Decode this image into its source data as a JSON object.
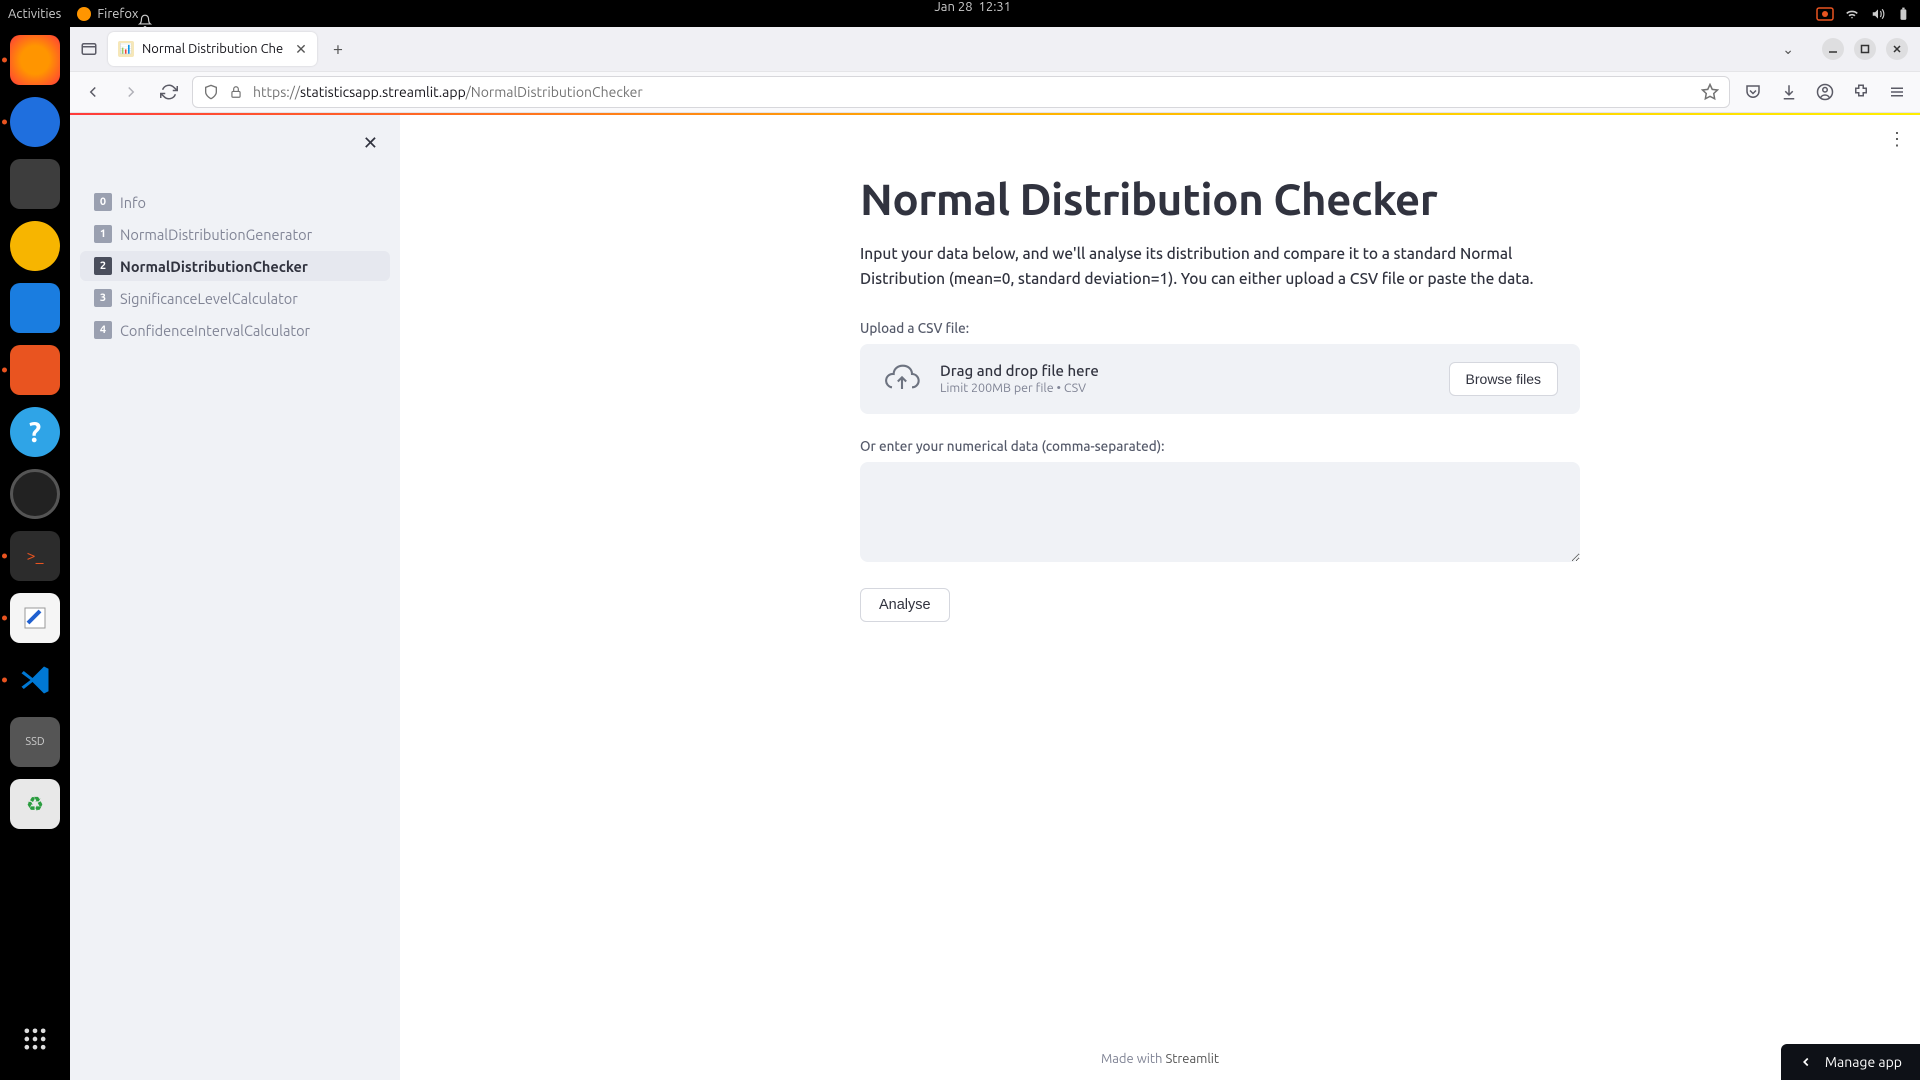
{
  "topbar": {
    "activities": "Activities",
    "app_name": "Firefox",
    "date": "Jan 28",
    "time": "12:31"
  },
  "browser": {
    "tab_title": "Normal Distribution Che",
    "url_scheme": "https://",
    "url_host": "statisticsapp.streamlit.app",
    "url_path": "/NormalDistributionChecker"
  },
  "sidebar": {
    "items": [
      {
        "num": "0",
        "label": "Info"
      },
      {
        "num": "1",
        "label": "NormalDistributionGenerator"
      },
      {
        "num": "2",
        "label": "NormalDistributionChecker"
      },
      {
        "num": "3",
        "label": "SignificanceLevelCalculator"
      },
      {
        "num": "4",
        "label": "ConfidenceIntervalCalculator"
      }
    ],
    "selected_index": 2
  },
  "main": {
    "title": "Normal Distribution Checker",
    "description": "Input your data below, and we'll analyse its distribution and compare it to a standard Normal Distribution (mean=0, standard deviation=1). You can either upload a CSV file or paste the data.",
    "upload_label": "Upload a CSV file:",
    "uploader": {
      "line1": "Drag and drop file here",
      "line2": "Limit 200MB per file • CSV",
      "browse_label": "Browse files"
    },
    "textarea_label": "Or enter your numerical data (comma-separated):",
    "analyse_label": "Analyse"
  },
  "footer": {
    "made_with": "Made with ",
    "streamlit": "Streamlit"
  },
  "manage_app": "Manage app"
}
